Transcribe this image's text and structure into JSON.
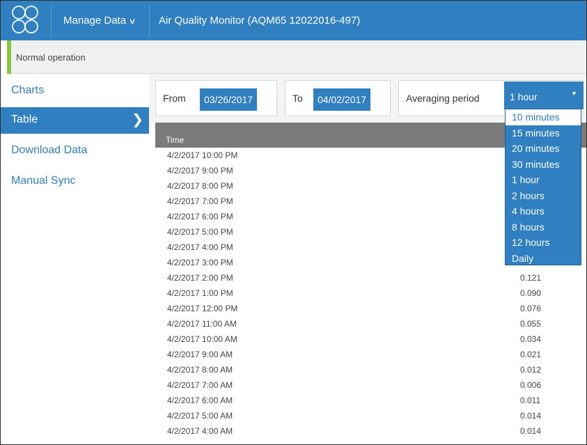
{
  "header": {
    "menu_label": "Manage Data",
    "title": "Air Quality Monitor (AQM65 12022016-497)"
  },
  "status": {
    "text": "Normal operation"
  },
  "sidebar": {
    "items": [
      {
        "label": "Charts",
        "active": false
      },
      {
        "label": "Table",
        "active": true
      },
      {
        "label": "Download Data",
        "active": false
      },
      {
        "label": "Manual Sync",
        "active": false
      }
    ]
  },
  "filter": {
    "from_label": "From",
    "from_value": "03/26/2017",
    "to_label": "To",
    "to_value": "04/02/2017",
    "averaging_label": "Averaging period",
    "averaging_value": "1 hour"
  },
  "dropdown": {
    "options": [
      "10 minutes",
      "15 minutes",
      "20 minutes",
      "30 minutes",
      "1 hour",
      "2 hours",
      "4 hours",
      "8 hours",
      "12 hours",
      "Daily"
    ],
    "highlighted": "10 minutes"
  },
  "table": {
    "column_header": "Time",
    "rows": [
      {
        "time": "4/2/2017 10:00 PM",
        "value": ""
      },
      {
        "time": "4/2/2017 9:00 PM",
        "value": ""
      },
      {
        "time": "4/2/2017 8:00 PM",
        "value": ""
      },
      {
        "time": "4/2/2017 7:00 PM",
        "value": ""
      },
      {
        "time": "4/2/2017 6:00 PM",
        "value": ""
      },
      {
        "time": "4/2/2017 5:00 PM",
        "value": ""
      },
      {
        "time": "4/2/2017 4:00 PM",
        "value": ""
      },
      {
        "time": "4/2/2017 3:00 PM",
        "value": ""
      },
      {
        "time": "4/2/2017 2:00 PM",
        "value": "0.121"
      },
      {
        "time": "4/2/2017 1:00 PM",
        "value": "0.090"
      },
      {
        "time": "4/2/2017 12:00 PM",
        "value": "0.076"
      },
      {
        "time": "4/2/2017 11:00 AM",
        "value": "0.055"
      },
      {
        "time": "4/2/2017 10:00 AM",
        "value": "0.034"
      },
      {
        "time": "4/2/2017 9:00 AM",
        "value": "0.021"
      },
      {
        "time": "4/2/2017 8:00 AM",
        "value": "0.012"
      },
      {
        "time": "4/2/2017 7:00 AM",
        "value": "0.006"
      },
      {
        "time": "4/2/2017 6:00 AM",
        "value": "0.011"
      },
      {
        "time": "4/2/2017 5:00 AM",
        "value": "0.014"
      },
      {
        "time": "4/2/2017 4:00 AM",
        "value": "0.014"
      }
    ]
  },
  "colors": {
    "accent": "#2f7fc1",
    "status_ok": "#8cc63f",
    "table_header": "#7a7a7a"
  }
}
